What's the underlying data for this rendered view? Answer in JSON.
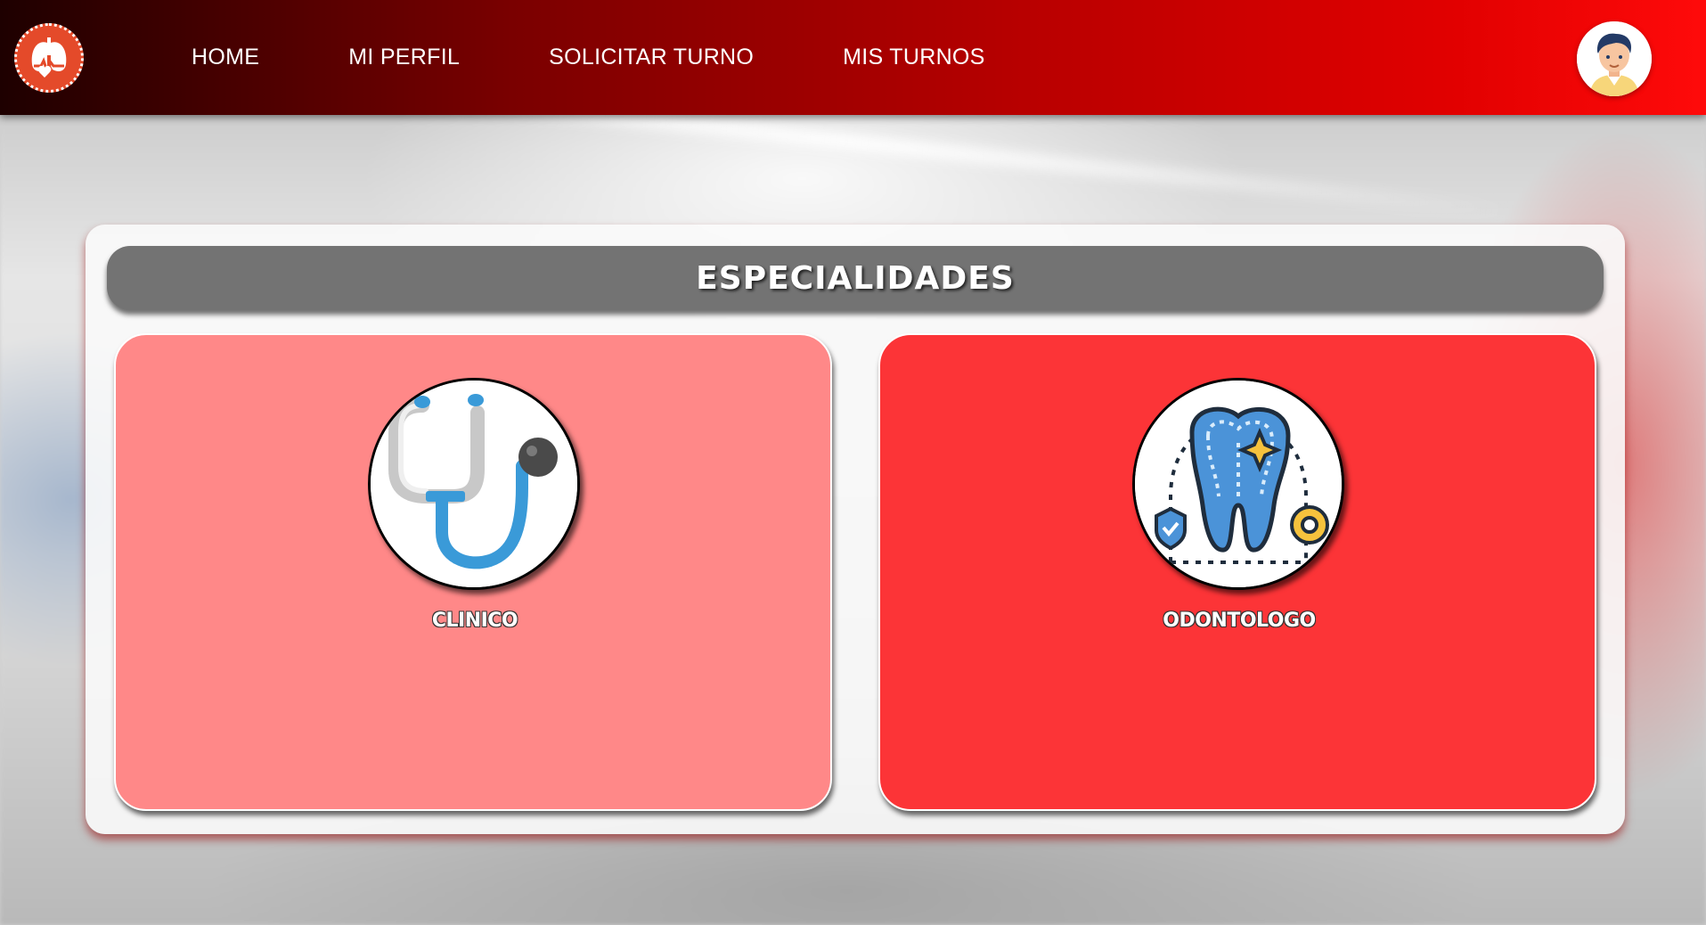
{
  "nav": {
    "links": [
      "HOME",
      "MI PERFIL",
      "SOLICITAR TURNO",
      "MIS TURNOS"
    ],
    "logo_icon": "lungs-heart-icon",
    "avatar_icon": "user-avatar-icon"
  },
  "panel": {
    "title": "ESPECIALIDADES",
    "cards": [
      {
        "label": "CLINICO",
        "icon": "stethoscope-icon",
        "color": "#ff8888"
      },
      {
        "label": "ODONTOLOGO",
        "icon": "tooth-icon",
        "color": "#fc3437"
      }
    ]
  },
  "colors": {
    "navbar_start": "#1e0000",
    "navbar_end": "#ff0a0a",
    "header_bar": "#737373"
  }
}
